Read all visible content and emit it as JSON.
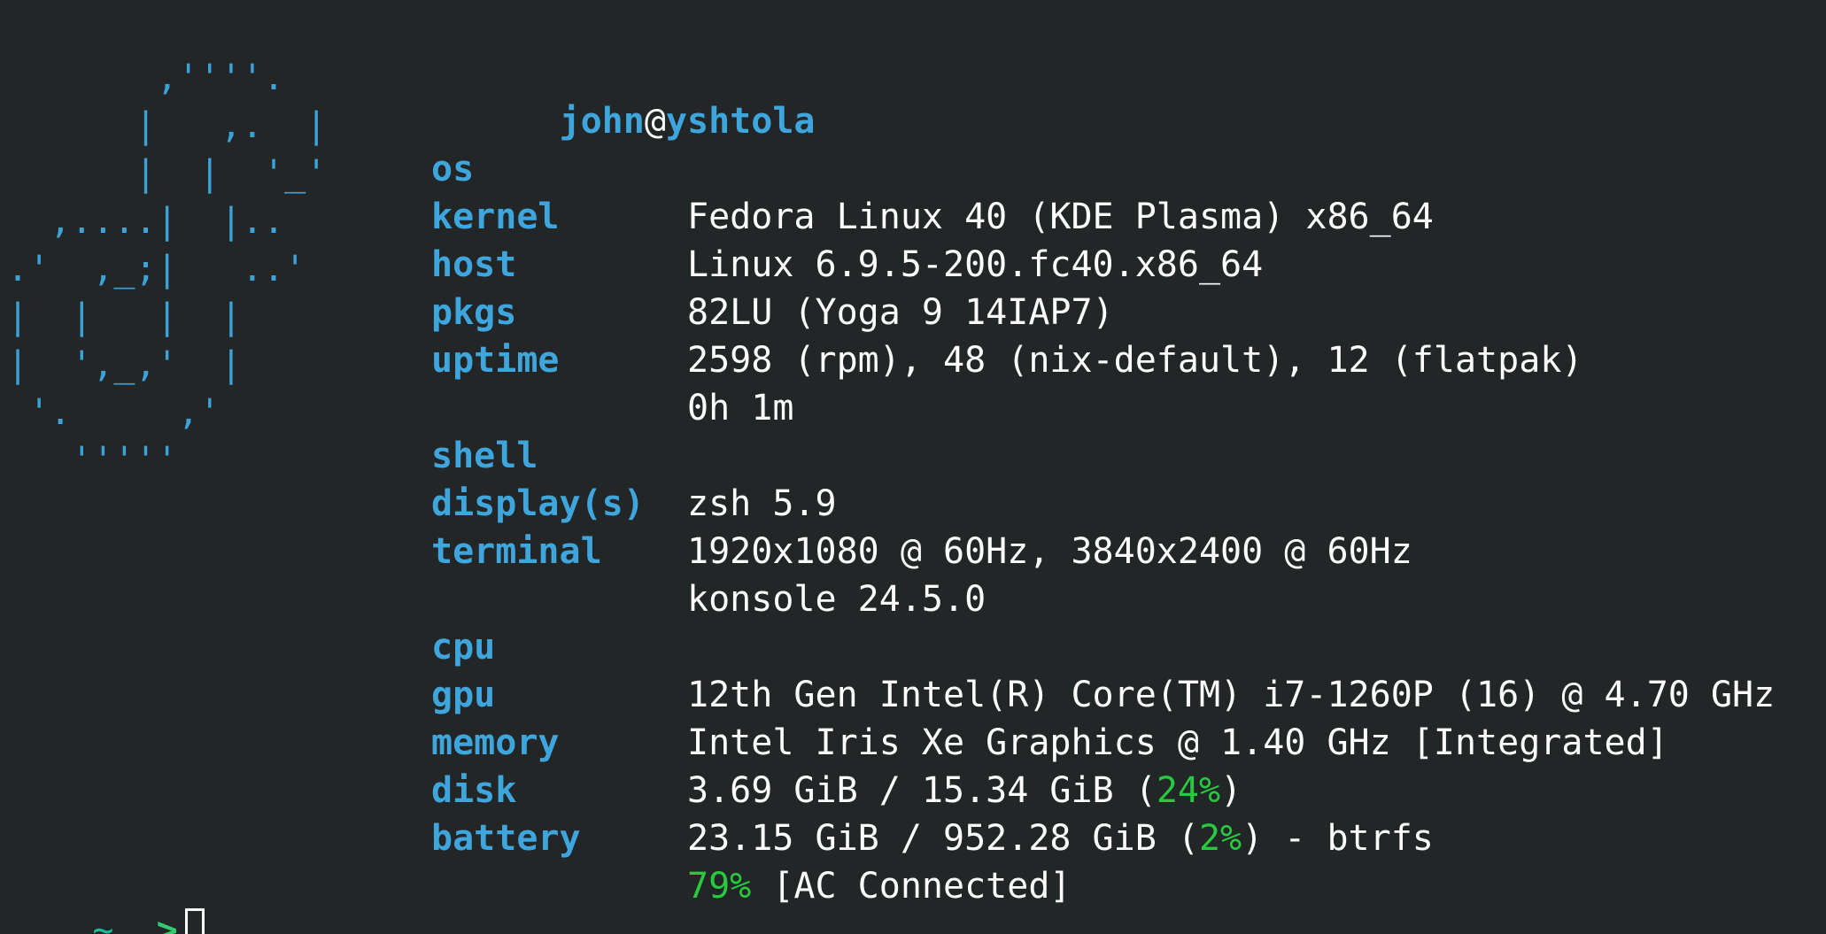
{
  "ascii_logo": "       ,''''.\n      |   ,.  |\n      |  |  '_'\n  ,....|  |..\n.'  ,_;|   ..'\n|  |   |  |\n|  ',_,'  |\n '.     ,'\n   '''''",
  "title": {
    "user": "john",
    "at": "@",
    "host": "yshtola"
  },
  "rows": [
    {
      "key": "os",
      "value": "Fedora Linux 40 (KDE Plasma) x86_64"
    },
    {
      "key": "kernel",
      "value": "Linux 6.9.5-200.fc40.x86_64"
    },
    {
      "key": "host",
      "value": "82LU (Yoga 9 14IAP7)"
    },
    {
      "key": "pkgs",
      "value": "2598 (rpm), 48 (nix-default), 12 (flatpak)"
    },
    {
      "key": "uptime",
      "value": "0h 1m"
    },
    {
      "key": "shell",
      "value": "zsh 5.9"
    },
    {
      "key": "display(s)",
      "value": "1920x1080 @ 60Hz, 3840x2400 @ 60Hz"
    },
    {
      "key": "terminal",
      "value": "konsole 24.5.0"
    },
    {
      "key": "cpu",
      "value": "12th Gen Intel(R) Core(TM) i7-1260P (16) @ 4.70 GHz"
    },
    {
      "key": "gpu",
      "value": "Intel Iris Xe Graphics @ 1.40 GHz [Integrated]"
    }
  ],
  "memory": {
    "key": "memory",
    "prefix": "3.69 GiB / 15.34 GiB (",
    "percent": "24%",
    "suffix": ")"
  },
  "disk": {
    "key": "disk",
    "prefix": "23.15 GiB / 952.28 GiB (",
    "percent": "2%",
    "suffix": ") - btrfs"
  },
  "battery": {
    "key": "battery",
    "percent": "79%",
    "suffix": " [AC Connected]"
  },
  "prompt": {
    "tilde": "~",
    "arrow": ">"
  },
  "colors": {
    "background": "#232627",
    "key": "#3ea6dd",
    "value": "#fcfcfc",
    "percent": "#27c93f"
  }
}
